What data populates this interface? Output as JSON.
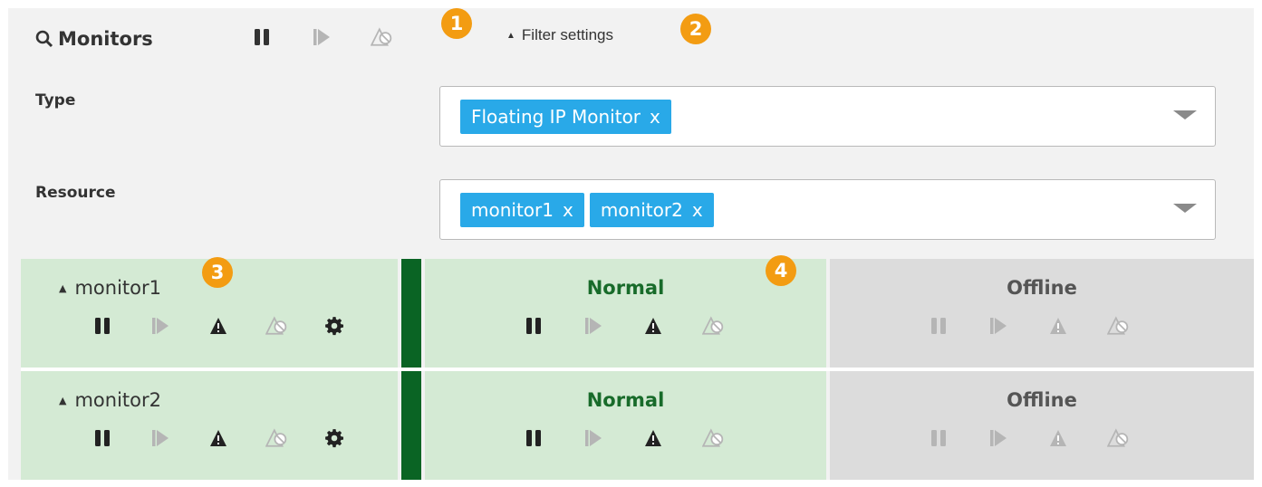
{
  "header": {
    "title": "Monitors",
    "title_icon": "search-icon",
    "actions": [
      "pause-icon",
      "resume-icon",
      "unsuspend-warning-icon"
    ],
    "filter_toggle": "Filter settings"
  },
  "callouts": [
    "1",
    "2",
    "3",
    "4"
  ],
  "filters": {
    "type": {
      "label": "Type",
      "chips": [
        {
          "text": "Floating IP Monitor",
          "remove": "x"
        }
      ]
    },
    "resource": {
      "label": "Resource",
      "chips": [
        {
          "text": "monitor1",
          "remove": "x"
        },
        {
          "text": "monitor2",
          "remove": "x"
        }
      ]
    }
  },
  "monitors": [
    {
      "name": "monitor1",
      "status": "Normal",
      "server_status": "Offline"
    },
    {
      "name": "monitor2",
      "status": "Normal",
      "server_status": "Offline"
    }
  ],
  "colors": {
    "accent": "#29a9e8",
    "callout": "#f39c12",
    "normal_bg": "#d4ead4",
    "normal_text": "#186b2a",
    "status_bar": "#0a6424",
    "offline_bg": "#dcdcdc"
  }
}
